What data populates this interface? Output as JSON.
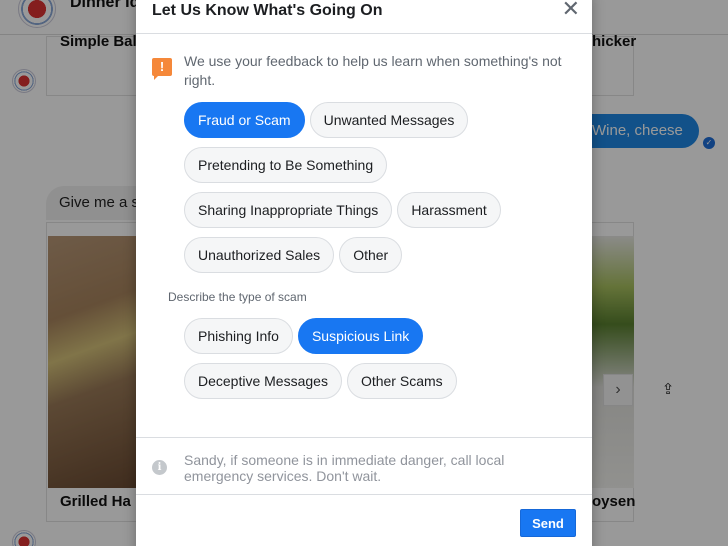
{
  "background": {
    "conversation_name": "Dinner Id",
    "card_top_left_title": "Simple Bal",
    "card_top_right_title": "hicker",
    "user_message": "Wine, cheese",
    "bot_message": "Give me a s",
    "card_bottom_left_title": "Grilled Ha",
    "card_bottom_right_title": "oysen",
    "next_icon": "›",
    "share_icon": "⇪",
    "seen_icon": "✓"
  },
  "modal": {
    "title": "Let Us Know What's Going On",
    "close_icon": "✕",
    "intro_icon": "!",
    "intro_text": "We use your feedback to help us learn when something's not right.",
    "categories": [
      {
        "label": "Fraud or Scam",
        "selected": true
      },
      {
        "label": "Unwanted Messages",
        "selected": false
      },
      {
        "label": "Pretending to Be Something",
        "selected": false
      },
      {
        "label": "Sharing Inappropriate Things",
        "selected": false
      },
      {
        "label": "Harassment",
        "selected": false
      },
      {
        "label": "Unauthorized Sales",
        "selected": false
      },
      {
        "label": "Other",
        "selected": false
      }
    ],
    "subtype_heading": "Describe the type of scam",
    "subtypes": [
      {
        "label": "Phishing Info",
        "selected": false
      },
      {
        "label": "Suspicious Link",
        "selected": true
      },
      {
        "label": "Deceptive Messages",
        "selected": false
      },
      {
        "label": "Other Scams",
        "selected": false
      }
    ],
    "info_icon": "i",
    "info_text": "Sandy, if someone is in immediate danger, call local emergency services. Don't wait.",
    "send_label": "Send"
  },
  "colors": {
    "accent": "#1877f2",
    "warning": "#f5883a"
  }
}
